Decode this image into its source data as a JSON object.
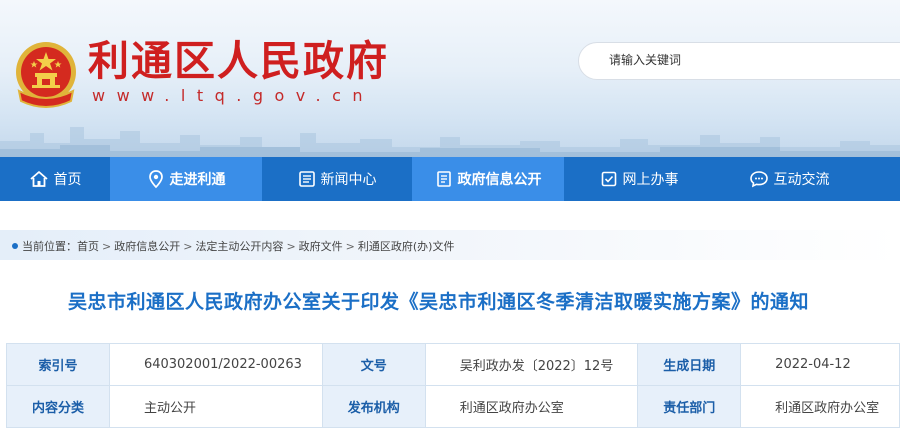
{
  "site": {
    "title": "利通区人民政府",
    "url": "www.ltq.gov.cn"
  },
  "search": {
    "placeholder": "请输入关键词"
  },
  "nav": {
    "items": [
      {
        "label": "首页",
        "icon": "home-icon"
      },
      {
        "label": "走进利通",
        "icon": "location-pin-icon"
      },
      {
        "label": "新闻中心",
        "icon": "news-icon"
      },
      {
        "label": "政府信息公开",
        "icon": "document-list-icon"
      },
      {
        "label": "网上办事",
        "icon": "checklist-icon"
      },
      {
        "label": "互动交流",
        "icon": "chat-bubble-icon"
      }
    ],
    "active_index": 1,
    "colors": {
      "bar": "#1b6fc6",
      "active": "#3a8ee8"
    }
  },
  "breadcrumb": {
    "prefix": "当前位置：",
    "items": [
      "首页",
      "政府信息公开",
      "法定主动公开内容",
      "政府文件",
      "利通区政府(办)文件"
    ],
    "separator": ">"
  },
  "document": {
    "title": "吴忠市利通区人民政府办公室关于印发《吴忠市利通区冬季清洁取暖实施方案》的通知"
  },
  "meta_table": {
    "rows": [
      {
        "k1": "索引号",
        "v1": "640302001/2022-00263",
        "k2": "文号",
        "v2": "吴利政办发〔2022〕12号",
        "k3": "生成日期",
        "v3": "2022-04-12"
      },
      {
        "k1": "内容分类",
        "v1": "主动公开",
        "k2": "发布机构",
        "v2": "利通区政府办公室",
        "k3": "责任部门",
        "v3": "利通区政府办公室"
      }
    ]
  },
  "colors": {
    "title_red": "#cf1f1f",
    "accent_blue": "#1b6fc6",
    "table_key_bg": "#e7f0fa"
  }
}
